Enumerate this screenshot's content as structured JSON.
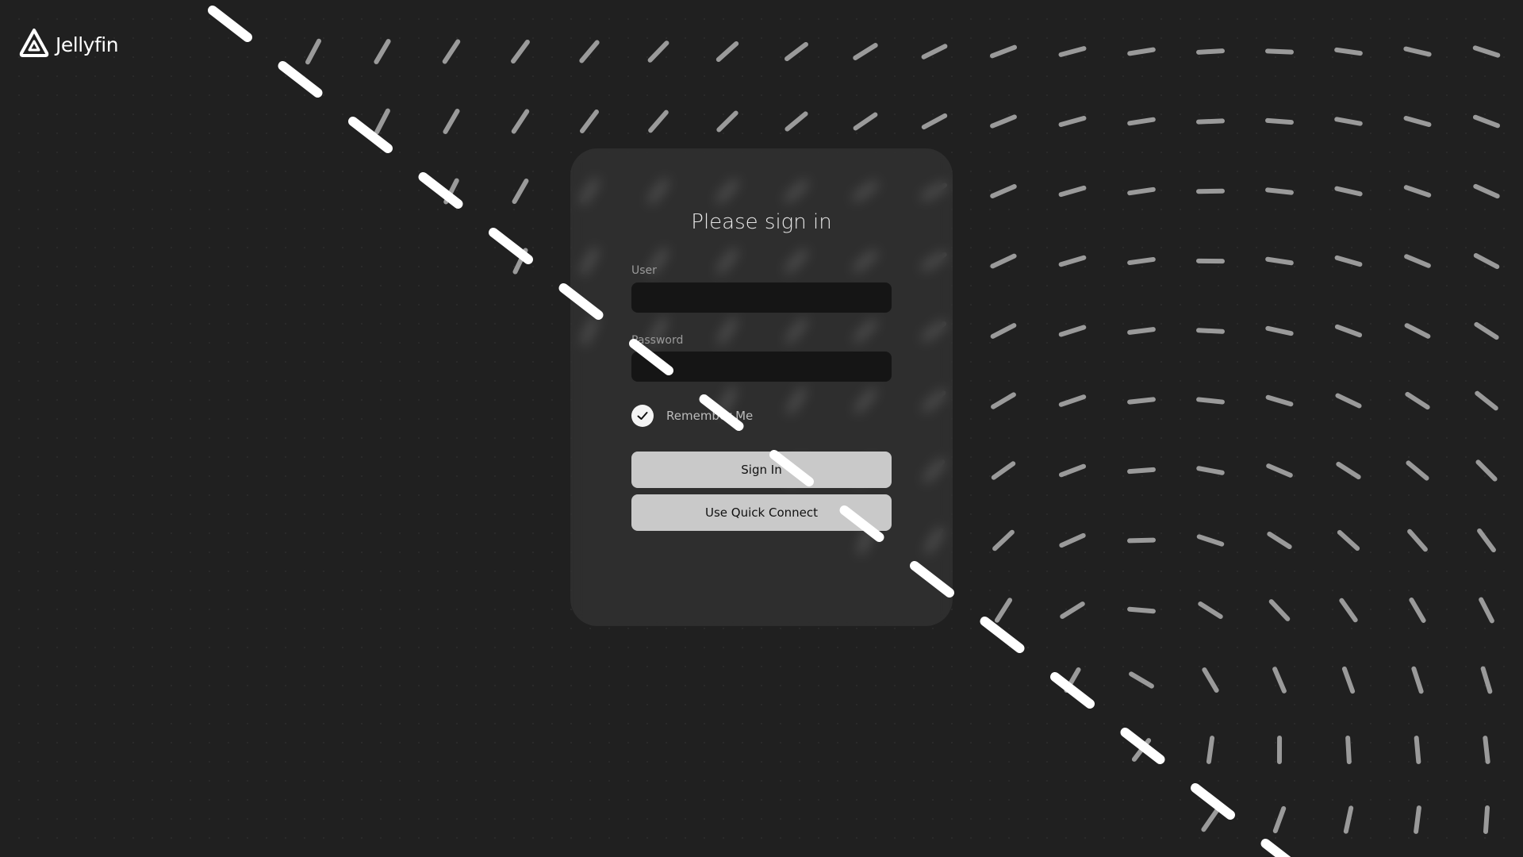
{
  "app": {
    "name": "Jellyfin",
    "logo_icon": "jellyfin-logo-icon"
  },
  "login": {
    "title": "Please sign in",
    "user_label": "User",
    "user_value": "",
    "password_label": "Password",
    "password_value": "",
    "remember_label": "Remember Me",
    "remember_checked": true,
    "sign_in_label": "Sign In",
    "quick_connect_label": "Use Quick Connect"
  },
  "colors": {
    "background": "#202020",
    "card": "#3a3a3a",
    "field": "#151515",
    "button": "#c9c9c9",
    "dash_field": "#9a9a9a",
    "dash_foreground": "#ffffff"
  }
}
